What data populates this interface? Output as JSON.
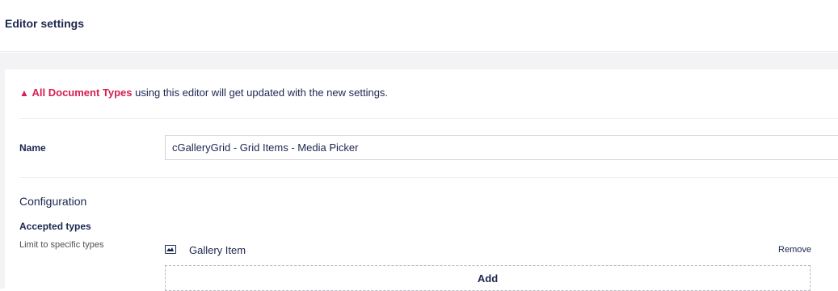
{
  "header": {
    "title": "Editor settings"
  },
  "warning": {
    "link_text": "All Document Types",
    "message": " using this editor will get updated with the new settings."
  },
  "name_field": {
    "label": "Name",
    "value": "cGalleryGrid - Grid Items - Media Picker"
  },
  "configuration": {
    "heading": "Configuration",
    "accepted_types": {
      "label": "Accepted types",
      "description": "Limit to specific types",
      "items": [
        {
          "name": "Gallery Item",
          "icon": "picture-icon",
          "remove_label": "Remove"
        }
      ],
      "add_label": "Add"
    }
  },
  "colors": {
    "accent": "#d42054",
    "text": "#1b264f",
    "background": "#f3f3f5"
  }
}
